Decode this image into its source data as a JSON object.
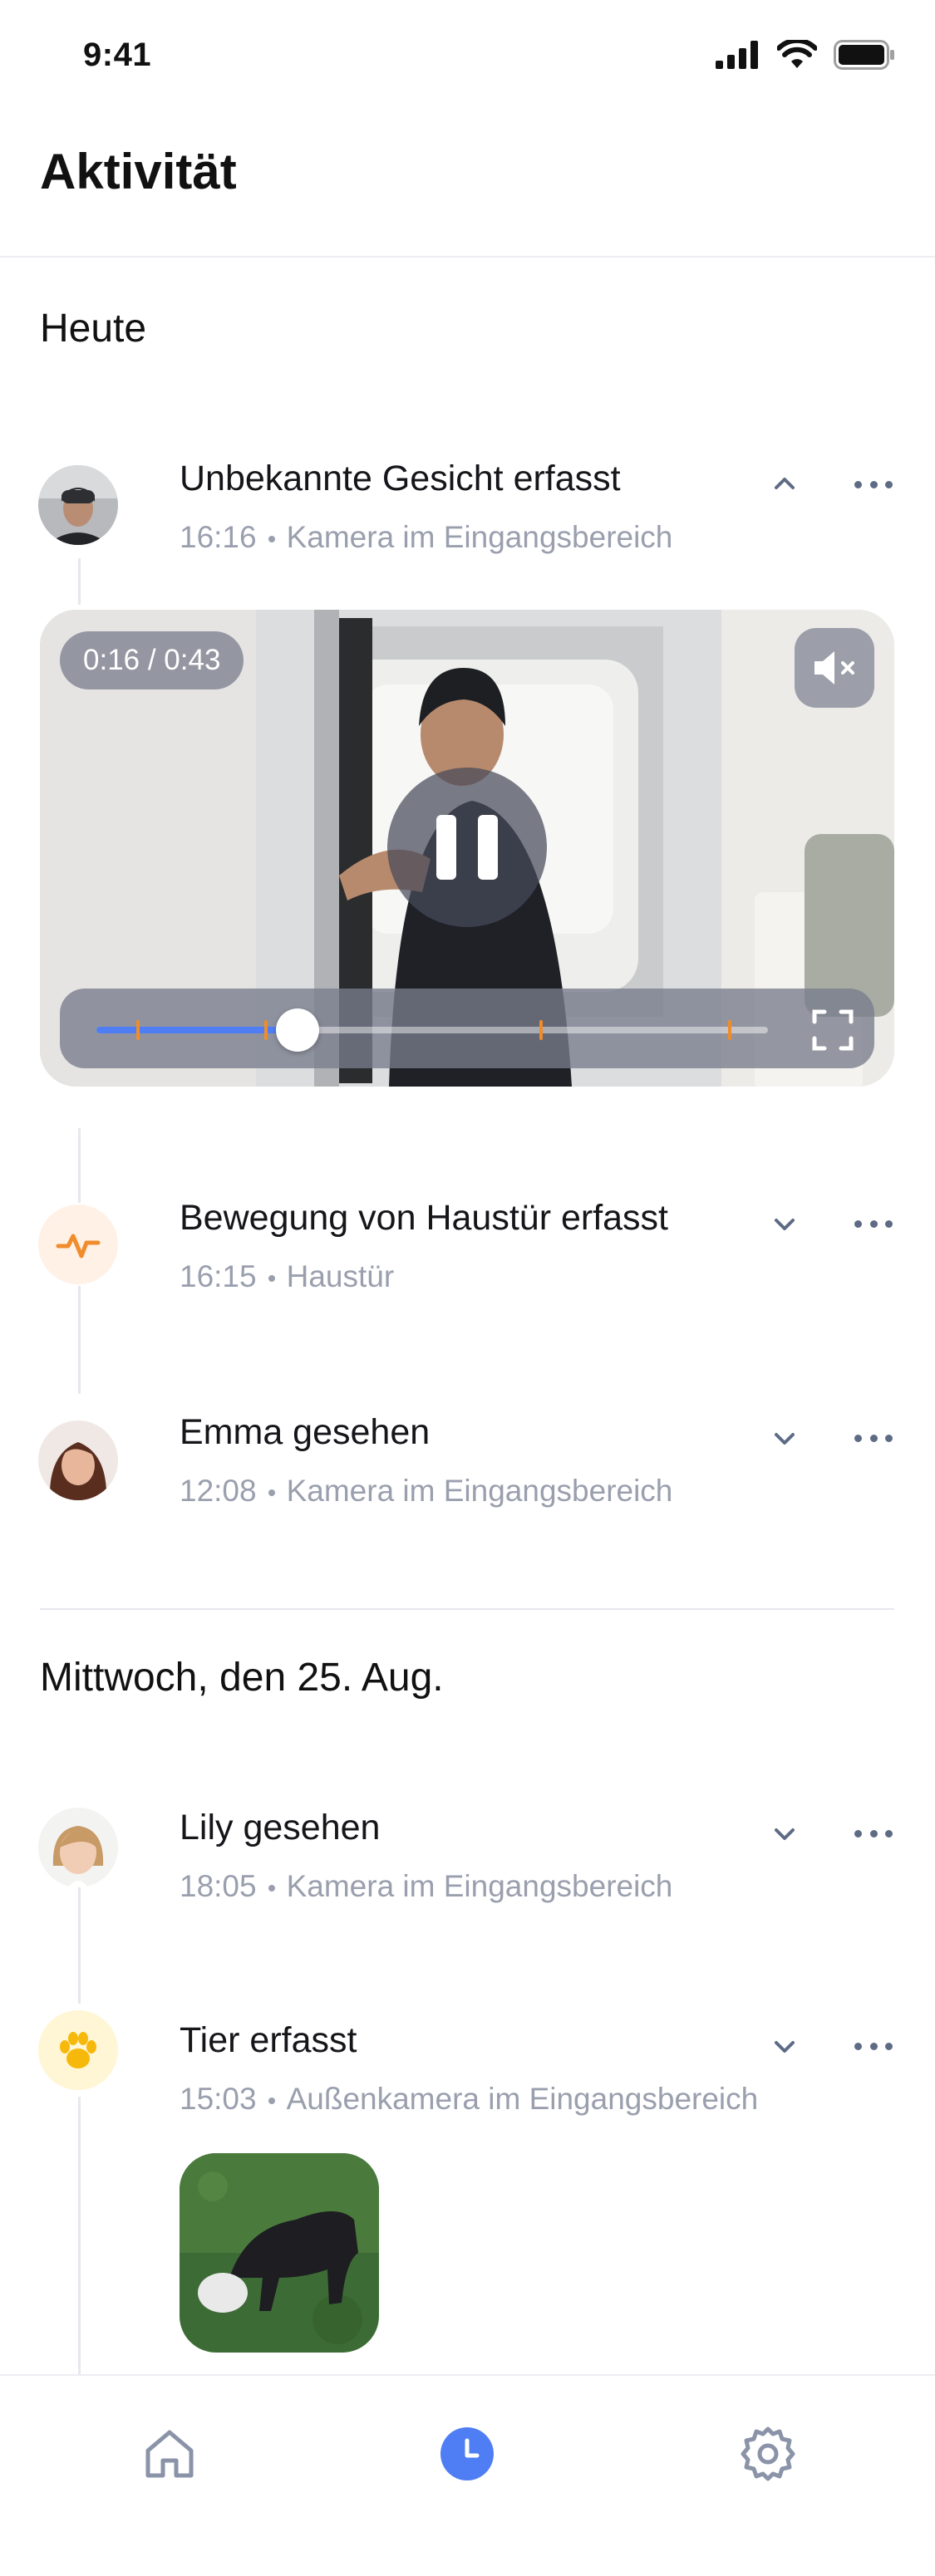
{
  "status_bar": {
    "time": "9:41",
    "icons": [
      "signal-icon",
      "wifi-icon",
      "battery-icon"
    ]
  },
  "header": {
    "title": "Aktivität"
  },
  "sections": [
    {
      "title": "Heute",
      "events": [
        {
          "title": "Unbekannte Gesicht erfasst",
          "time": "16:16",
          "location": "Kamera im Eingangsbereich",
          "expanded": true,
          "icon": "unknown-face-avatar"
        },
        {
          "title": "Bewegung von Haustür erfasst",
          "time": "16:15",
          "location": "Haustür",
          "expanded": false,
          "icon": "activity-pulse-icon"
        },
        {
          "title": "Emma gesehen",
          "time": "12:08",
          "location": "Kamera im Eingangsbereich",
          "expanded": false,
          "icon": "emma-avatar"
        }
      ]
    },
    {
      "title": "Mittwoch, den 25. Aug.",
      "events": [
        {
          "title": "Lily gesehen",
          "time": "18:05",
          "location": "Kamera im Eingangsbereich",
          "expanded": false,
          "icon": "lily-avatar"
        },
        {
          "title": "Tier erfasst",
          "time": "15:03",
          "location": "Außenkamera im Eingangsbereich",
          "expanded": false,
          "icon": "paw-icon"
        }
      ]
    }
  ],
  "video_player": {
    "time_display": "0:16 / 0:43",
    "progress": 0.3,
    "event_markers": [
      0.06,
      0.25,
      0.66,
      0.94
    ],
    "muted": true,
    "playing": true
  },
  "colors": {
    "accent": "#4f7ef4",
    "marker": "#f08c2c",
    "meta_text": "#9a9fae",
    "motion_bg": "#fff1e6",
    "paw_bg": "#fff6d6"
  },
  "tab_bar": {
    "tabs": [
      "home-icon",
      "history-clock-icon",
      "settings-gear-icon"
    ],
    "active": "history-clock-icon"
  }
}
